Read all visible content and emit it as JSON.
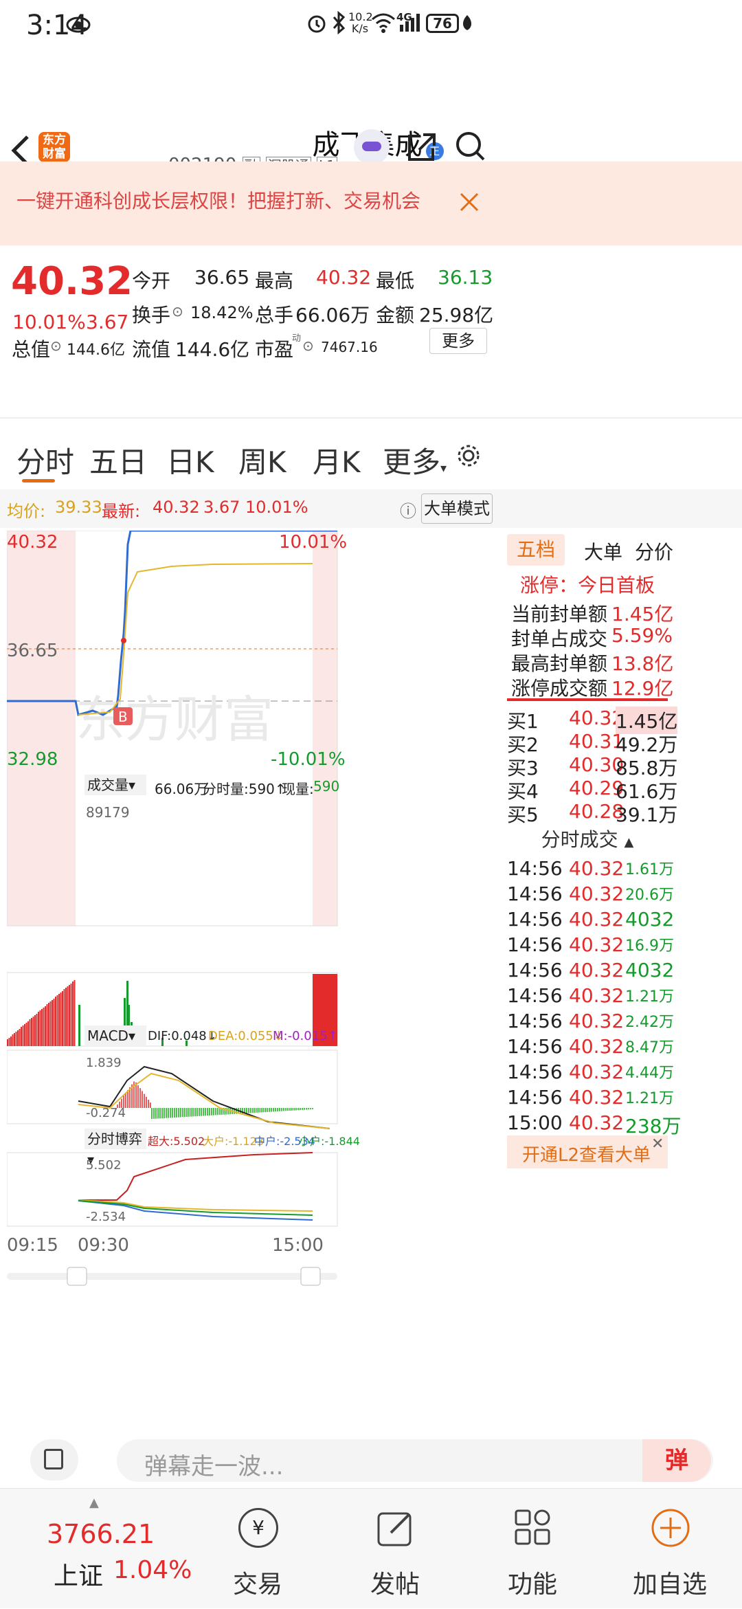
{
  "status": {
    "time": "3:14",
    "net_speed_top": "10.2",
    "net_speed_bottom": "K/s",
    "signal": "4G",
    "battery": "76"
  },
  "header": {
    "logo_top": "东方",
    "logo_bottom": "财富",
    "title": "成飞集成",
    "title_badge": "正",
    "code": "002190",
    "tag1": "融",
    "tag2": "深股通",
    "tag3": "L1"
  },
  "banner": {
    "text": "一键开通科创成长层权限！把握打新、交易机会"
  },
  "quote": {
    "price": "40.32",
    "pct": "10.01%",
    "chg": "3.67",
    "open_label": "今开",
    "open": "36.65",
    "high_label": "最高",
    "high": "40.32",
    "low_label": "最低",
    "low": "36.13",
    "turnover_label": "换手",
    "turnover": "18.42%",
    "vol_label": "总手",
    "vol": "66.06万",
    "amount_label": "金额",
    "amount": "25.98亿",
    "mcap_label": "总值",
    "mcap": "144.6亿",
    "float_label": "流值",
    "float": "144.6亿",
    "pe_label": "市盈",
    "pe_sup": "动",
    "pe": "7467.16",
    "more": "更多"
  },
  "tabs": [
    "分时",
    "五日",
    "日K",
    "周K",
    "月K",
    "更多"
  ],
  "info": {
    "avg_label": "均价:",
    "avg": "39.33",
    "latest_label": "最新:",
    "latest": "40.32",
    "chg": "3.67",
    "pct": "10.01%",
    "mode": "大单模式"
  },
  "chart": {
    "top_price": "40.32",
    "top_pct": "10.01%",
    "mid_price": "36.65",
    "bottom_price": "32.98",
    "bottom_pct": "-10.01%",
    "watermark": "东方财富",
    "b_marker": "B",
    "vol_label": "成交量",
    "vol_total": "66.06万",
    "vol_min": "分时量:590↑",
    "vol_now_label": "现量:",
    "vol_now": "590",
    "vol_max": "89179",
    "macd_label": "MACD",
    "dif": "DIF:0.048↓",
    "dea": "DEA:0.055↓",
    "m": "M:-0.015↑",
    "macd_top": "1.839",
    "macd_bottom": "-0.274",
    "game_label": "分时博弈",
    "super": "超大:5.502",
    "big": "大户:-1.123",
    "mid": "中户:-2.534",
    "small": "小户:-1.844",
    "game_top": "5.502",
    "game_bottom": "-2.534",
    "t_start": "09:15",
    "t_open": "09:30",
    "t_end": "15:00"
  },
  "right": {
    "tabs": [
      "五档",
      "大单",
      "分价"
    ],
    "limit_title": "涨停：今日首板",
    "limit_rows": [
      {
        "k": "当前封单额",
        "v": "1.45亿"
      },
      {
        "k": "封单占成交",
        "v": "5.59%"
      },
      {
        "k": "最高封单额",
        "v": "13.8亿"
      },
      {
        "k": "涨停成交额",
        "v": "12.9亿"
      }
    ],
    "bids": [
      {
        "k": "买1",
        "p": "40.32",
        "v": "1.45亿"
      },
      {
        "k": "买2",
        "p": "40.31",
        "v": "49.2万"
      },
      {
        "k": "买3",
        "p": "40.30",
        "v": "85.8万"
      },
      {
        "k": "买4",
        "p": "40.29",
        "v": "61.6万"
      },
      {
        "k": "买5",
        "p": "40.28",
        "v": "39.1万"
      }
    ],
    "trades_title": "分时成交",
    "trades": [
      {
        "t": "14:56",
        "p": "40.32",
        "v": "1.61万"
      },
      {
        "t": "14:56",
        "p": "40.32",
        "v": "20.6万"
      },
      {
        "t": "14:56",
        "p": "40.32",
        "v": "4032"
      },
      {
        "t": "14:56",
        "p": "40.32",
        "v": "16.9万"
      },
      {
        "t": "14:56",
        "p": "40.32",
        "v": "4032"
      },
      {
        "t": "14:56",
        "p": "40.32",
        "v": "1.21万"
      },
      {
        "t": "14:56",
        "p": "40.32",
        "v": "2.42万"
      },
      {
        "t": "14:56",
        "p": "40.32",
        "v": "8.47万"
      },
      {
        "t": "14:56",
        "p": "40.32",
        "v": "4.44万"
      },
      {
        "t": "14:56",
        "p": "40.32",
        "v": "1.21万"
      },
      {
        "t": "15:00",
        "p": "40.32",
        "v": "238万"
      }
    ],
    "l2": "开通L2查看大单"
  },
  "danmu": {
    "placeholder": "弹幕走一波...",
    "btn": "弹"
  },
  "nav": {
    "index_value": "3766.21",
    "index_name": "上证",
    "index_pct": "1.04%",
    "items": [
      "交易",
      "发帖",
      "功能",
      "加自选"
    ]
  },
  "colors": {
    "up": "#e32b2b",
    "down": "#159a2c",
    "accent": "#e36d15",
    "banner_bg": "#fde9e0"
  }
}
